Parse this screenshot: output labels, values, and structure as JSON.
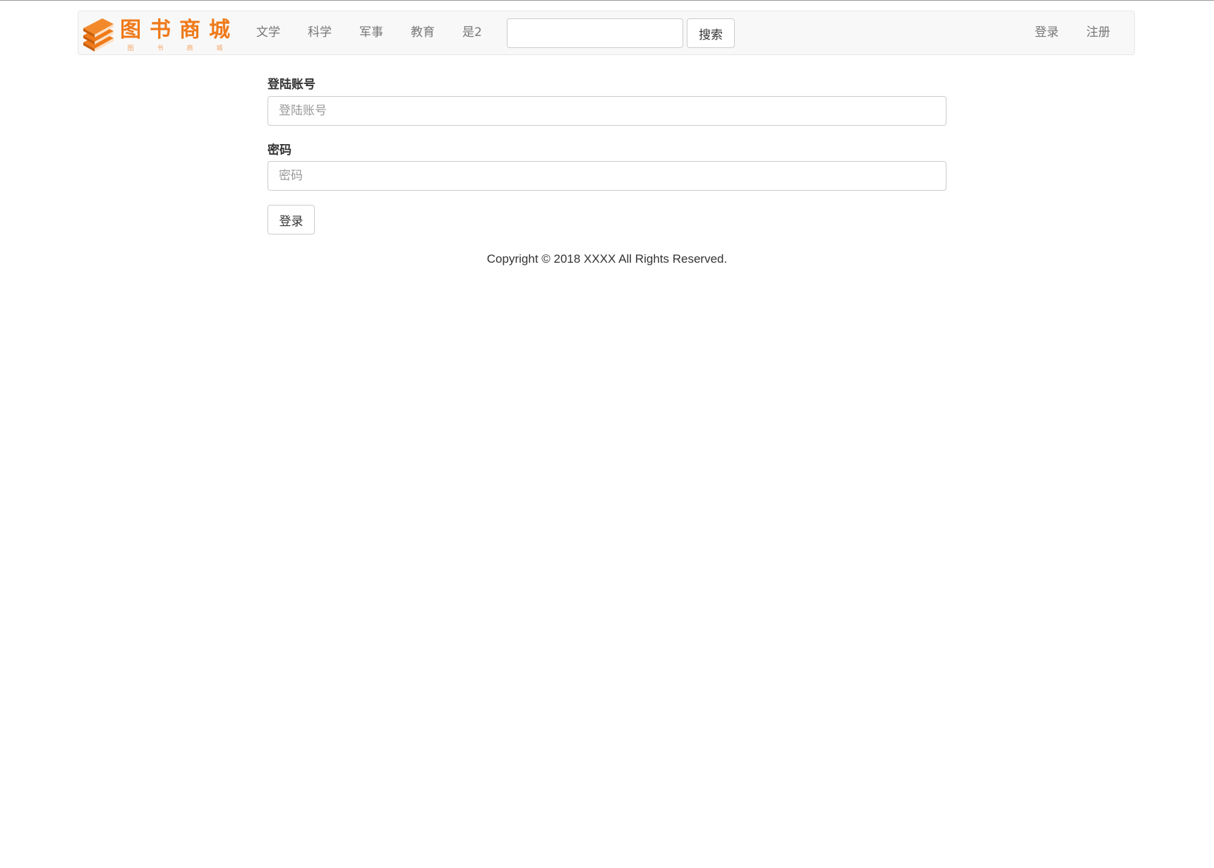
{
  "brand": {
    "title_chars": [
      "图",
      "书",
      "商",
      "城"
    ],
    "subtitle_chars": [
      "图",
      "书",
      "商",
      "城"
    ],
    "color": "#ef7a19"
  },
  "nav": {
    "categories": [
      "文学",
      "科学",
      "军事",
      "教育",
      "是2"
    ],
    "search_placeholder": "",
    "search_button": "搜索",
    "login": "登录",
    "register": "注册"
  },
  "form": {
    "account_label": "登陆账号",
    "account_placeholder": "登陆账号",
    "password_label": "密码",
    "password_placeholder": "密码",
    "submit_label": "登录"
  },
  "footer": {
    "copyright": "Copyright © 2018 XXXX All Rights Reserved."
  }
}
